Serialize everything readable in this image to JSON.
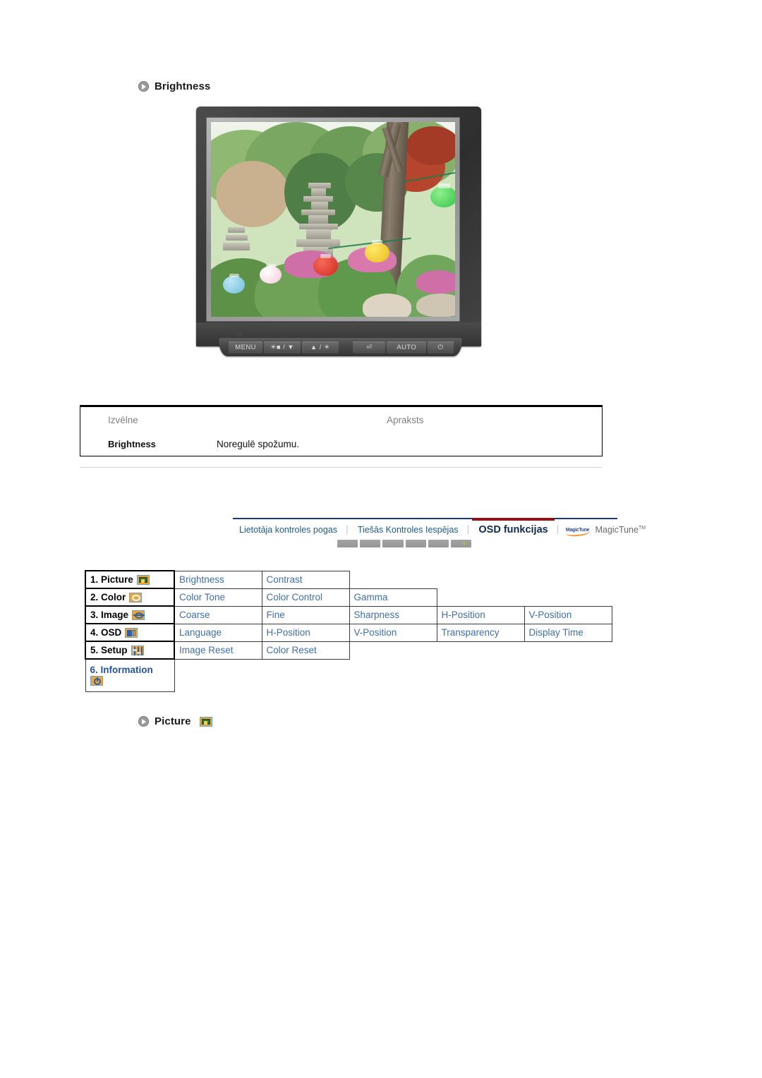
{
  "top_section": {
    "heading": "Brightness",
    "bullet_icon": "arrow-bullet-icon"
  },
  "monitor": {
    "name": "lcd-monitor-illustration",
    "screen_content": "Korean garden with stone pagoda and colored paper lanterns",
    "buttons": [
      {
        "name": "menu-button",
        "label": "MENU"
      },
      {
        "name": "source-down-button",
        "label": "☀■ / ▼"
      },
      {
        "name": "up-brightness-button",
        "label": "▲ / ☀"
      },
      {
        "name": "enter-button",
        "label": "⏎"
      },
      {
        "name": "auto-button",
        "label": "AUTO"
      },
      {
        "name": "power-button",
        "label": "⏻"
      }
    ]
  },
  "description_table": {
    "headers": {
      "menu": "Izvēlne",
      "description": "Apraksts"
    },
    "rows": [
      {
        "menu": "Brightness",
        "description": "Noregulē spožumu."
      }
    ]
  },
  "nav": {
    "items": [
      {
        "label": "Lietotāja kontroles pogas",
        "active": false
      },
      {
        "label": "Tiešās Kontroles Iespējas",
        "active": false
      },
      {
        "label": "OSD funkcijas",
        "active": true
      },
      {
        "label": "MagicTune",
        "active": false,
        "trademark": "TM",
        "logo_text": "MagicTune"
      }
    ],
    "separator": "│",
    "active_color": "#8e1414",
    "rule_color": "#1a3a6b",
    "link_color": "#1d5b86"
  },
  "osd_table": {
    "rows": [
      {
        "category": "1. Picture",
        "icon": "picture-icon",
        "items": [
          "Brightness",
          "Contrast"
        ]
      },
      {
        "category": "2. Color",
        "icon": "color-icon",
        "items": [
          "Color Tone",
          "Color Control",
          "Gamma"
        ]
      },
      {
        "category": "3. Image",
        "icon": "image-icon",
        "items": [
          "Coarse",
          "Fine",
          "Sharpness",
          "H-Position",
          "V-Position"
        ]
      },
      {
        "category": "4. OSD",
        "icon": "osd-icon",
        "items": [
          "Language",
          "H-Position",
          "V-Position",
          "Transparency",
          "Display Time"
        ]
      },
      {
        "category": "5. Setup",
        "icon": "setup-icon",
        "items": [
          "Image Reset",
          "Color Reset"
        ]
      },
      {
        "category": "6. Information",
        "icon": "information-icon",
        "items": []
      }
    ],
    "category_color": "#000000",
    "item_color": "#3f6fa8",
    "information_color": "#27539b",
    "icon_fill": "#eaa63a",
    "icon_border": "#6f9fd0"
  },
  "bottom_section": {
    "heading": "Picture",
    "bullet_icon": "arrow-bullet-icon",
    "icon": "picture-icon"
  }
}
